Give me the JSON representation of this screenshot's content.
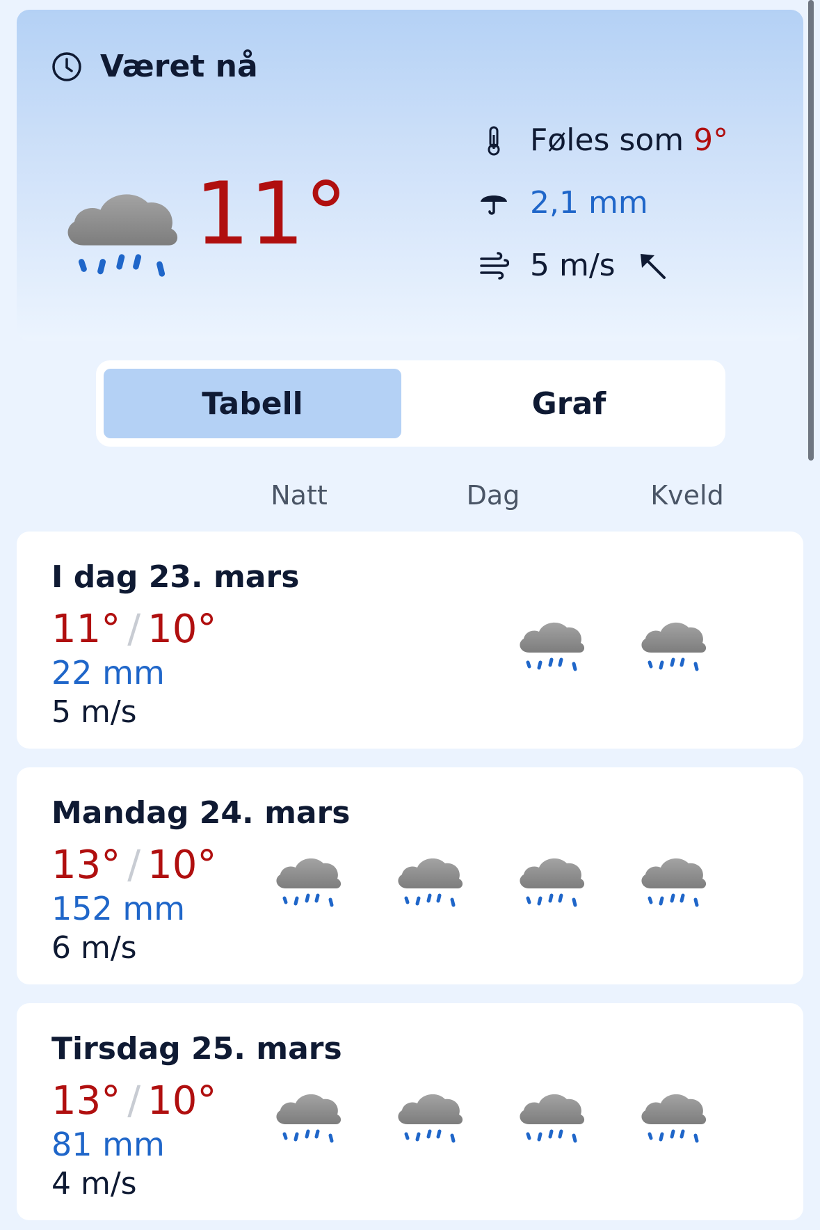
{
  "now": {
    "title": "Været nå",
    "temperature": "11°",
    "feels_label": "Føles som",
    "feels_value": "9°",
    "precipitation": "2,1 mm",
    "wind": "5 m/s",
    "icon": "rain-cloud-icon"
  },
  "toggle": {
    "table_label": "Tabell",
    "graph_label": "Graf",
    "selected": "Tabell"
  },
  "columns": [
    "Natt",
    "Dag",
    "Kveld"
  ],
  "days": [
    {
      "title": "I dag 23. mars",
      "max": "11°",
      "min": "10°",
      "precip": "22 mm",
      "wind": "5 m/s",
      "icons": [
        "",
        "",
        "rain-cloud-icon",
        "rain-cloud-icon"
      ]
    },
    {
      "title": "Mandag 24. mars",
      "max": "13°",
      "min": "10°",
      "precip": "152 mm",
      "wind": "6 m/s",
      "icons": [
        "rain-cloud-icon",
        "rain-cloud-icon",
        "rain-cloud-icon",
        "rain-cloud-icon"
      ]
    },
    {
      "title": "Tirsdag 25. mars",
      "max": "13°",
      "min": "10°",
      "precip": "81 mm",
      "wind": "4 m/s",
      "icons": [
        "rain-cloud-icon",
        "rain-cloud-icon",
        "rain-cloud-icon",
        "rain-cloud-icon"
      ]
    }
  ],
  "colors": {
    "temperature": "#b00f0f",
    "precipitation": "#1f66c9",
    "accent": "#b4d1f5",
    "background": "#ebf3fe"
  }
}
